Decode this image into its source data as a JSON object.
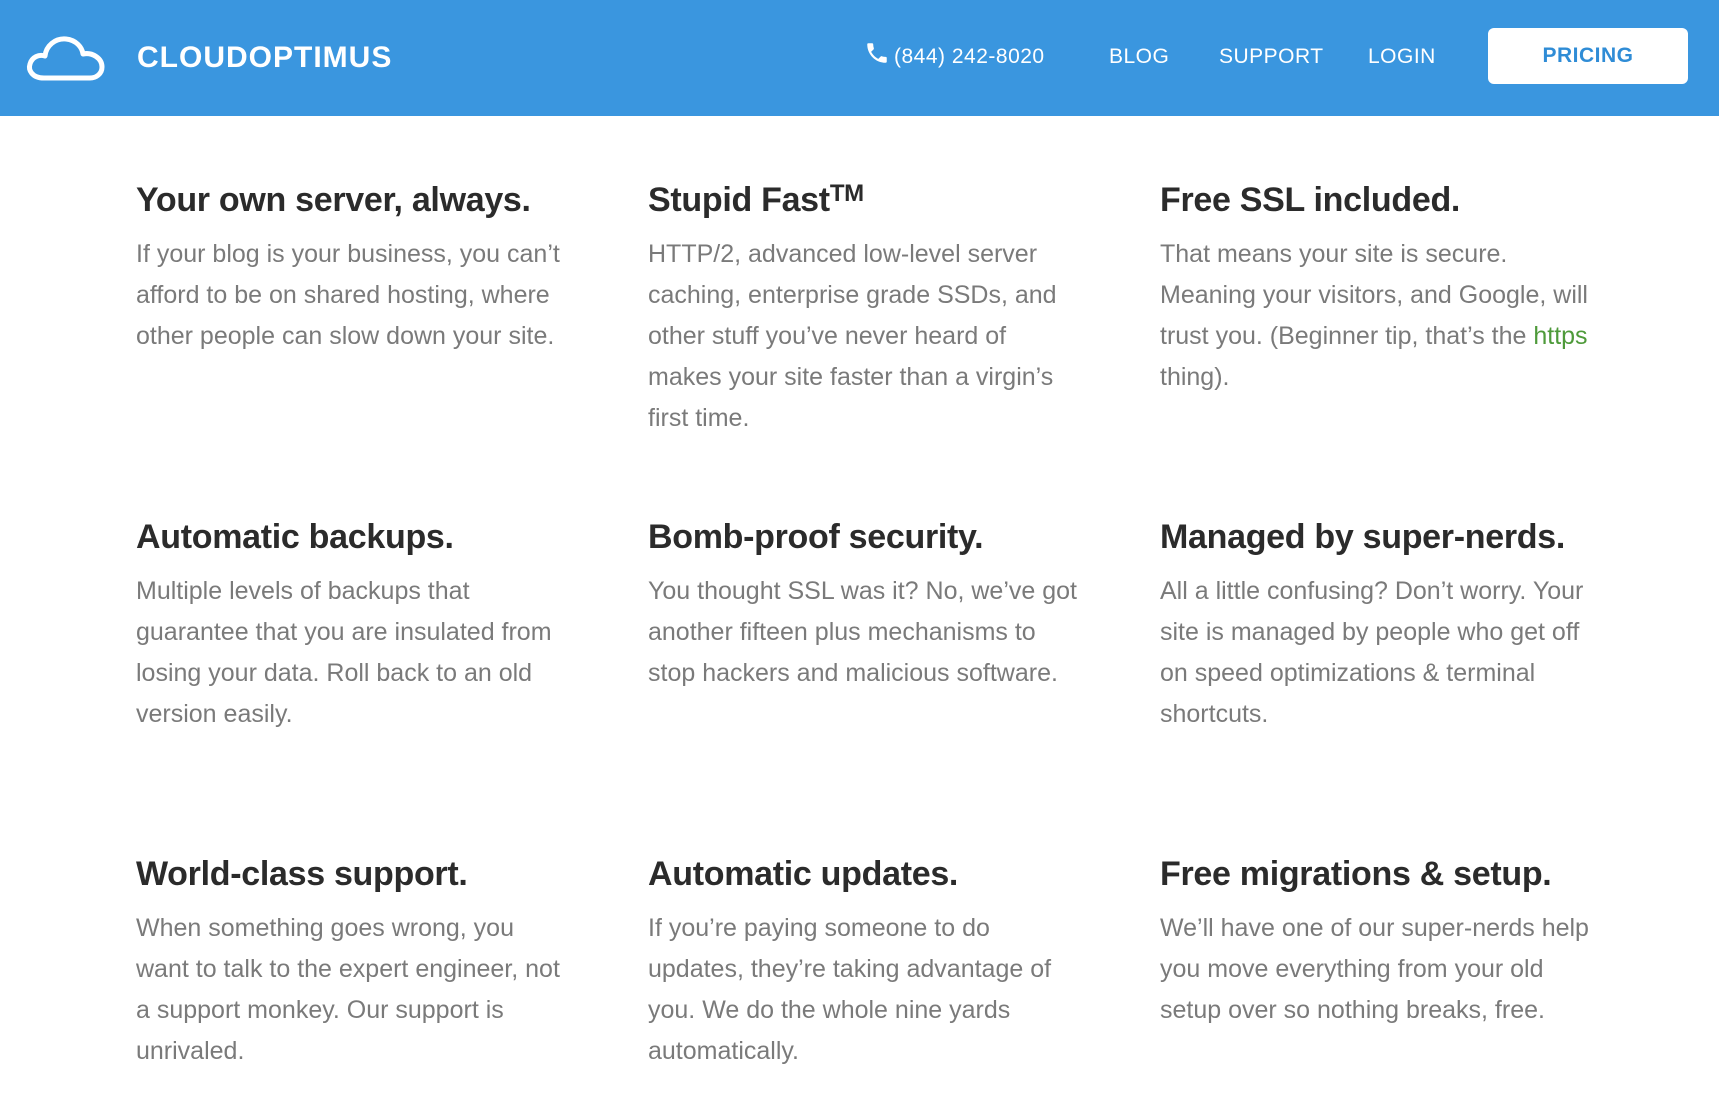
{
  "header": {
    "logo_icon": "cloud-icon",
    "brand": "CLOUDOPTIMUS",
    "phone_icon": "phone-icon",
    "phone": "(844) 242-8020",
    "nav": {
      "blog": "BLOG",
      "support": "SUPPORT",
      "login": "LOGIN"
    },
    "pricing": "PRICING",
    "bg_color": "#3a96df"
  },
  "features": [
    {
      "title": "Your own server, always.",
      "body": "If your blog is your business, you can’t afford to be on shared hosting, where other people can slow down your site."
    },
    {
      "title": "Stupid Fast",
      "title_sup": "TM",
      "body": "HTTP/2, advanced low-level server caching, enterprise grade SSDs, and other stuff you’ve never heard of makes your site faster than a virgin’s first time."
    },
    {
      "title": "Free SSL included.",
      "body_before_link": "That means your site is secure. Meaning your visitors, and Google, will trust you. (Beginner tip, that’s the ",
      "body_link": "https",
      "body_after_link": " thing)."
    },
    {
      "title": "Automatic backups.",
      "body": "Multiple levels of backups that guarantee that you are insulated from losing your data. Roll back to an old version easily."
    },
    {
      "title": "Bomb-proof security.",
      "body": "You thought SSL was it? No, we’ve got another fifteen plus mechanisms to stop hackers and malicious software."
    },
    {
      "title": "Managed by super-nerds.",
      "body": "All a little confusing? Don’t worry. Your site is managed by people who get off on speed optimizations & terminal shortcuts."
    },
    {
      "title": "World-class support.",
      "body": "When something goes wrong, you want to talk to the expert engineer, not a support monkey. Our support is unrivaled."
    },
    {
      "title": "Automatic updates.",
      "body": "If you’re paying someone to do updates, they’re taking advantage of you. We do the whole nine yards automatically."
    },
    {
      "title": "Free migrations & setup.",
      "body": "We’ll have one of our super-nerds help you move everything from your old setup over so nothing breaks, free."
    }
  ],
  "colors": {
    "heading": "#2b2b2b",
    "body_text": "#7a7a7a",
    "link": "#4e9a3a",
    "accent": "#3a96df"
  }
}
